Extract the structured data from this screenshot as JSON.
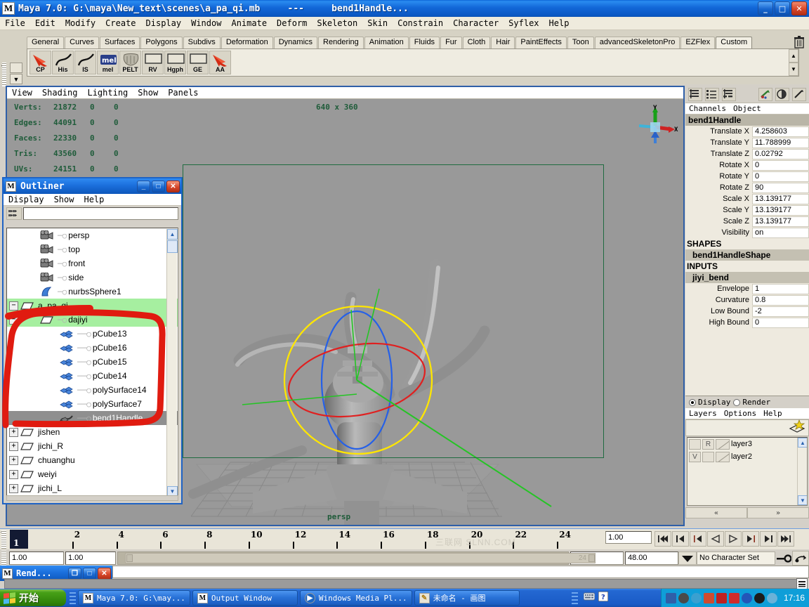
{
  "titlebar": {
    "app_icon": "maya-icon",
    "title": "Maya 7.0: G:\\maya\\New_text\\scenes\\a_pa_qi.mb     ---     bend1Handle...",
    "minimize": "_",
    "maximize": "□",
    "close": "✕"
  },
  "menubar": {
    "items": [
      "File",
      "Edit",
      "Modify",
      "Create",
      "Display",
      "Window",
      "Animate",
      "Deform",
      "Skeleton",
      "Skin",
      "Constrain",
      "Character",
      "Syflex",
      "Help"
    ]
  },
  "shelf": {
    "tabs": [
      "General",
      "Curves",
      "Surfaces",
      "Polygons",
      "Subdivs",
      "Deformation",
      "Dynamics",
      "Rendering",
      "Animation",
      "Fluids",
      "Fur",
      "Cloth",
      "Hair",
      "PaintEffects",
      "Toon",
      "advancedSkeletonPro",
      "EZFlex",
      "Custom"
    ],
    "active_tab": "Custom",
    "trash_icon": "trash-icon",
    "buttons": [
      {
        "label": "CP",
        "icon": "red-arrow-icon"
      },
      {
        "label": "His",
        "icon": "curve-icon"
      },
      {
        "label": "IS",
        "icon": "curve-icon"
      },
      {
        "label": "mel",
        "icon": "mel-icon"
      },
      {
        "label": "PELT",
        "icon": "pelt-icon"
      },
      {
        "label": "RV",
        "icon": "rect-icon"
      },
      {
        "label": "Hgph",
        "icon": "rect-icon"
      },
      {
        "label": "GE",
        "icon": "rect-icon"
      },
      {
        "label": "AA",
        "icon": "red-arrow-icon"
      }
    ],
    "scroll_up": "▲",
    "scroll_down": "▼"
  },
  "viewport": {
    "menu": [
      "View",
      "Shading",
      "Lighting",
      "Show",
      "Panels"
    ],
    "hud": [
      {
        "label": "Verts:",
        "v1": "21872",
        "v2": "0",
        "v3": "0"
      },
      {
        "label": "Edges:",
        "v1": "44091",
        "v2": "0",
        "v3": "0"
      },
      {
        "label": "Faces:",
        "v1": "22330",
        "v2": "0",
        "v3": "0"
      },
      {
        "label": "Tris:",
        "v1": "43560",
        "v2": "0",
        "v3": "0"
      },
      {
        "label": "UVs:",
        "v1": "24151",
        "v2": "0",
        "v3": "0"
      }
    ],
    "resolution": "640 x 360",
    "camera_label": "persp",
    "axis_x": "X",
    "axis_y": "Y"
  },
  "outliner": {
    "title": "Outliner",
    "window_icon": "maya-icon",
    "minimize": "_",
    "maximize": "□",
    "close": "✕",
    "menu": [
      "Display",
      "Show",
      "Help"
    ],
    "search_value": "",
    "toolbar_icon": "outliner-filter-icon",
    "scroll_up": "▲",
    "scroll_down": "▼",
    "rows": [
      {
        "label": "persp",
        "icon": "camera-icon",
        "indent": 1,
        "expander": "",
        "state": "none"
      },
      {
        "label": "top",
        "icon": "camera-icon",
        "indent": 1,
        "expander": "",
        "state": "none"
      },
      {
        "label": "front",
        "icon": "camera-icon",
        "indent": 1,
        "expander": "",
        "state": "none"
      },
      {
        "label": "side",
        "icon": "camera-icon",
        "indent": 1,
        "expander": "",
        "state": "none"
      },
      {
        "label": "nurbsSphere1",
        "icon": "nurbs-icon",
        "indent": 1,
        "expander": "",
        "state": "none"
      },
      {
        "label": "a_pa_qi",
        "icon": "transform-icon",
        "indent": 0,
        "expander": "−",
        "state": "sel-green"
      },
      {
        "label": "dajiyi",
        "icon": "transform-icon",
        "indent": 1,
        "expander": "−",
        "state": "sel-green"
      },
      {
        "label": "pCube13",
        "icon": "mesh-icon",
        "indent": 2,
        "expander": "",
        "state": "none"
      },
      {
        "label": "pCube16",
        "icon": "mesh-icon",
        "indent": 2,
        "expander": "",
        "state": "none"
      },
      {
        "label": "pCube15",
        "icon": "mesh-icon",
        "indent": 2,
        "expander": "",
        "state": "none"
      },
      {
        "label": "pCube14",
        "icon": "mesh-icon",
        "indent": 2,
        "expander": "",
        "state": "none"
      },
      {
        "label": "polySurface14",
        "icon": "mesh-icon",
        "indent": 2,
        "expander": "",
        "state": "none"
      },
      {
        "label": "polySurface7",
        "icon": "mesh-icon",
        "indent": 2,
        "expander": "",
        "state": "none"
      },
      {
        "label": "bend1Handle",
        "icon": "deformer-icon",
        "indent": 2,
        "expander": "",
        "state": "sel-grey"
      },
      {
        "label": "jishen",
        "icon": "transform-icon",
        "indent": 0,
        "expander": "+",
        "state": "none"
      },
      {
        "label": "jichi_R",
        "icon": "transform-icon",
        "indent": 0,
        "expander": "+",
        "state": "none"
      },
      {
        "label": "chuanghu",
        "icon": "transform-icon",
        "indent": 0,
        "expander": "+",
        "state": "none"
      },
      {
        "label": "weiyi",
        "icon": "transform-icon",
        "indent": 0,
        "expander": "+",
        "state": "none"
      },
      {
        "label": "jichi_L",
        "icon": "transform-icon",
        "indent": 0,
        "expander": "+",
        "state": "none"
      }
    ],
    "annotation_color": "#e01b10"
  },
  "channelbox": {
    "icons": [
      "channel-box-icon",
      "attribute-editor-icon",
      "tool-settings-icon",
      "paint-icon",
      "render-globals-icon",
      "eyedropper-icon"
    ],
    "menu": [
      "Channels",
      "Object"
    ],
    "object_name": "bend1Handle",
    "attributes": [
      {
        "name": "Translate X",
        "value": "4.258603"
      },
      {
        "name": "Translate Y",
        "value": "11.788999"
      },
      {
        "name": "Translate Z",
        "value": "0.02792"
      },
      {
        "name": "Rotate X",
        "value": "0"
      },
      {
        "name": "Rotate Y",
        "value": "0"
      },
      {
        "name": "Rotate Z",
        "value": "90"
      },
      {
        "name": "Scale X",
        "value": "13.139177"
      },
      {
        "name": "Scale Y",
        "value": "13.139177"
      },
      {
        "name": "Scale Z",
        "value": "13.139177"
      },
      {
        "name": "Visibility",
        "value": "on"
      }
    ],
    "shapes_label": "SHAPES",
    "shape_name": "bend1HandleShape",
    "inputs_label": "INPUTS",
    "input_name": "jiyi_bend",
    "input_attributes": [
      {
        "name": "Envelope",
        "value": "1"
      },
      {
        "name": "Curvature",
        "value": "0.8"
      },
      {
        "name": "Low Bound",
        "value": "-2"
      },
      {
        "name": "High Bound",
        "value": "0"
      }
    ]
  },
  "layers": {
    "display_label": "Display",
    "render_label": "Render",
    "selected_mode": "Display",
    "menu": [
      "Layers",
      "Options",
      "Help"
    ],
    "new_layer_icon": "new-layer-icon",
    "scroll_up": "▲",
    "scroll_down": "▼",
    "rows": [
      {
        "visibility": "",
        "mode": "R",
        "name": "layer3"
      },
      {
        "visibility": "V",
        "mode": "",
        "name": "layer2"
      }
    ],
    "nav_prev": "«",
    "nav_next": "»"
  },
  "timeline": {
    "ticks": [
      "2",
      "4",
      "6",
      "8",
      "10",
      "12",
      "14",
      "16",
      "18",
      "20",
      "22",
      "24"
    ],
    "current_frame": "1",
    "current_frame_field": "1.00",
    "watermark": "三联网 SLNN.COM",
    "playback_buttons": [
      "go-to-start-icon",
      "step-back-key-icon",
      "step-back-frame-icon",
      "play-backwards-icon",
      "play-forwards-icon",
      "step-forward-frame-icon",
      "step-forward-key-icon",
      "go-to-end-icon"
    ]
  },
  "range": {
    "start_field": "1.00",
    "start_field2": "1.00",
    "range_handle_label": "24",
    "end_field": "24.00",
    "max_field": "48.00",
    "dropdown_icon": "chevron-down-icon",
    "character_set": "No Character Set",
    "key_icon": "key-icon",
    "anim_pref_icon": "animation-preferences-icon"
  },
  "render_window": {
    "title": "Rend...",
    "icon": "maya-icon",
    "restore": "❐",
    "maximize": "□",
    "close": "✕"
  },
  "command_line": {
    "value": ""
  },
  "status_help": {
    "value": ""
  },
  "taskbar": {
    "start_label": "开始",
    "items": [
      {
        "label": "Maya 7.0: G:\\may...",
        "icon": "maya-icon"
      },
      {
        "label": "Output Window",
        "icon": "maya-icon"
      },
      {
        "label": "Windows Media Pl...",
        "icon": "media-player-icon"
      },
      {
        "label": "未命名 - 画图",
        "icon": "paint-icon"
      }
    ],
    "tray_icons": [
      "keyboard-icon",
      "help-icon",
      "network-icon",
      "volume-icon",
      "globe-icon",
      "antivirus-icon",
      "shield-icon",
      "update-icon",
      "info-icon",
      "acrobat-icon",
      "sound-icon"
    ],
    "clock": "17:16"
  }
}
